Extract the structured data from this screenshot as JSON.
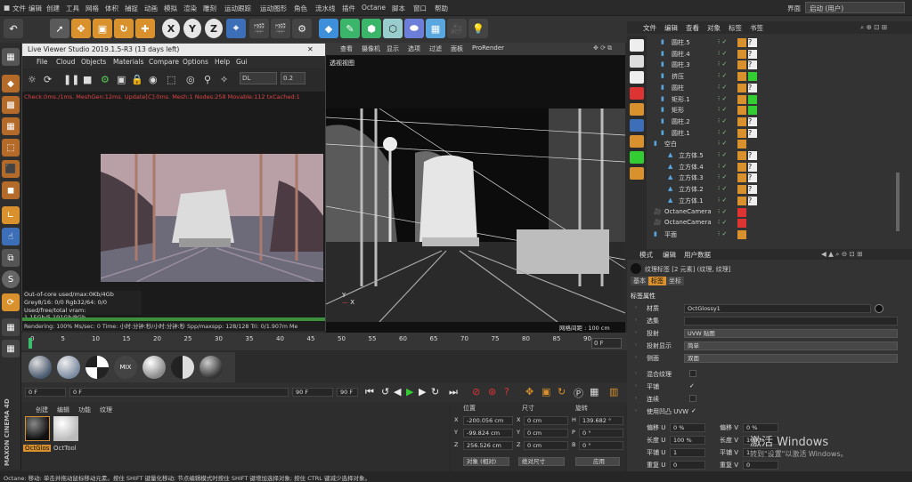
{
  "menubar": {
    "items": [
      "文件",
      "编辑",
      "创建",
      "工具",
      "网格",
      "体积",
      "捕捉",
      "动画",
      "模拟",
      "渲染",
      "雕刻",
      "运动跟踪",
      "运动图形",
      "角色",
      "流水线",
      "插件",
      "Octane",
      "脚本",
      "窗口",
      "帮助"
    ],
    "layout_label": "界面",
    "layout_value": "启动 (用户)"
  },
  "live_viewer": {
    "title": "Live Viewer Studio 2019.1.5-R3 (13 days left)",
    "menu": [
      "File",
      "Cloud",
      "Objects",
      "Materials",
      "Compare",
      "Options",
      "Help",
      "Gui"
    ],
    "mode": "DL",
    "value": "0.2",
    "status": "Check:0ms./1ms. MeshGen:12ms. Update[C]:0ms. Mesh:1 Nodes:258 Movable:112 txCached:1",
    "info": [
      "Out-of-core used/max:0Kb/4Gb",
      "Grey8/16: 0/0       Rgb32/64: 0/0",
      "Used/free/total vram: 1.15Gb/5.191Gb/8Gb"
    ],
    "bottom": "Rendering: 100%  Ms/sec: 0  Time: 小时:分钟:秒/小时:分钟:秒  Spp/maxspp: 128/128  Tri: 0/1.907m  Me"
  },
  "viewport": {
    "tabs": [
      "查看",
      "摄像机",
      "显示",
      "选项",
      "过滤",
      "面板",
      "ProRender"
    ],
    "label": "透视视图",
    "grid": "网格间距 : 100 cm"
  },
  "timeline": {
    "ticks": [
      "0",
      "5",
      "10",
      "15",
      "20",
      "25",
      "30",
      "35",
      "40",
      "45",
      "50",
      "55",
      "60",
      "65",
      "70",
      "75",
      "80",
      "85",
      "90"
    ],
    "end": "0 F"
  },
  "playback": {
    "start": "0 F",
    "current": "0 F",
    "end": "90 F",
    "end2": "90 F"
  },
  "material_manager": {
    "menu": [
      "创建",
      "编辑",
      "功能",
      "纹理"
    ],
    "materials": [
      "OctGlos",
      "OctTool"
    ]
  },
  "coords": {
    "headers": [
      "位置",
      "尺寸",
      "旋转"
    ],
    "rows": [
      {
        "axis": "X",
        "pos": "-200.056 cm",
        "size_axis": "X",
        "size": "0 cm",
        "rot_axis": "H",
        "rot": "139.682 °"
      },
      {
        "axis": "Y",
        "pos": "-99.824 cm",
        "size_axis": "Y",
        "size": "0 cm",
        "rot_axis": "P",
        "rot": "0 °"
      },
      {
        "axis": "Z",
        "pos": "256.526 cm",
        "size_axis": "Z",
        "size": "0 cm",
        "rot_axis": "B",
        "rot": "0 °"
      }
    ],
    "mode1": "对象 (相对)",
    "mode2": "绝对尺寸",
    "apply": "应用"
  },
  "object_manager": {
    "tabs": [
      "文件",
      "编辑",
      "查看",
      "对象",
      "标签",
      "书签"
    ],
    "objects": [
      {
        "name": "圆柱.5",
        "indent": 1
      },
      {
        "name": "圆柱.4",
        "indent": 1
      },
      {
        "name": "圆柱.3",
        "indent": 1
      },
      {
        "name": "挤压",
        "indent": 1
      },
      {
        "name": "圆柱",
        "indent": 1
      },
      {
        "name": "矩形.1",
        "indent": 1
      },
      {
        "name": "矩形",
        "indent": 1
      },
      {
        "name": "圆柱.2",
        "indent": 1
      },
      {
        "name": "圆柱.1",
        "indent": 1
      },
      {
        "name": "空白",
        "indent": 0
      },
      {
        "name": "立方体.5",
        "indent": 2
      },
      {
        "name": "立方体.4",
        "indent": 2
      },
      {
        "name": "立方体.3",
        "indent": 2
      },
      {
        "name": "立方体.2",
        "indent": 2
      },
      {
        "name": "立方体.1",
        "indent": 2
      },
      {
        "name": "OctaneCamera",
        "indent": 0
      },
      {
        "name": "OctaneCamera",
        "indent": 0
      },
      {
        "name": "平面",
        "indent": 0
      }
    ]
  },
  "attribute_manager": {
    "tabs": [
      "模式",
      "编辑",
      "用户数据"
    ],
    "title": "纹理标签 [2 元素] (纹理, 纹理]",
    "subtabs": [
      "基本",
      "标签",
      "坐标"
    ],
    "section": "标签属性",
    "material_label": "材质",
    "material_value": "OctGlossy1",
    "selection_label": "选集",
    "projection_label": "投射",
    "projection_value": "UVW 贴图",
    "projection_display_label": "投射显示",
    "projection_display_value": "简单",
    "side_label": "侧面",
    "side_value": "双面",
    "mix_label": "混合纹理",
    "tile_label": "平铺",
    "seamless_label": "连续",
    "uvw_label": "使用凹凸 UVW",
    "offset_u_label": "偏移 U",
    "offset_u": "0 %",
    "offset_v_label": "偏移 V",
    "offset_v": "0 %",
    "length_u_label": "长度 U",
    "length_u": "100 %",
    "length_v_label": "长度 V",
    "length_v": "100 %",
    "tiles_u_label": "平铺 U",
    "tiles_u": "1",
    "tiles_v_label": "平铺 V",
    "tiles_v": "1",
    "repeat_u_label": "重复 U",
    "repeat_u": "0",
    "repeat_v_label": "重复 V",
    "repeat_v": "0"
  },
  "watermark": {
    "line1": "激活 Windows",
    "line2": "转到\"设置\"以激活 Windows。"
  },
  "brand": "MAXON CINEMA 4D",
  "statusbar": "Octane:          移动: 单击并拖动鼠标移动元素。按住 SHIFT 键量化移动; 节点编辑模式时按住 SHIFT 键增加选择对象; 按住 CTRL 键减少选择对象。"
}
